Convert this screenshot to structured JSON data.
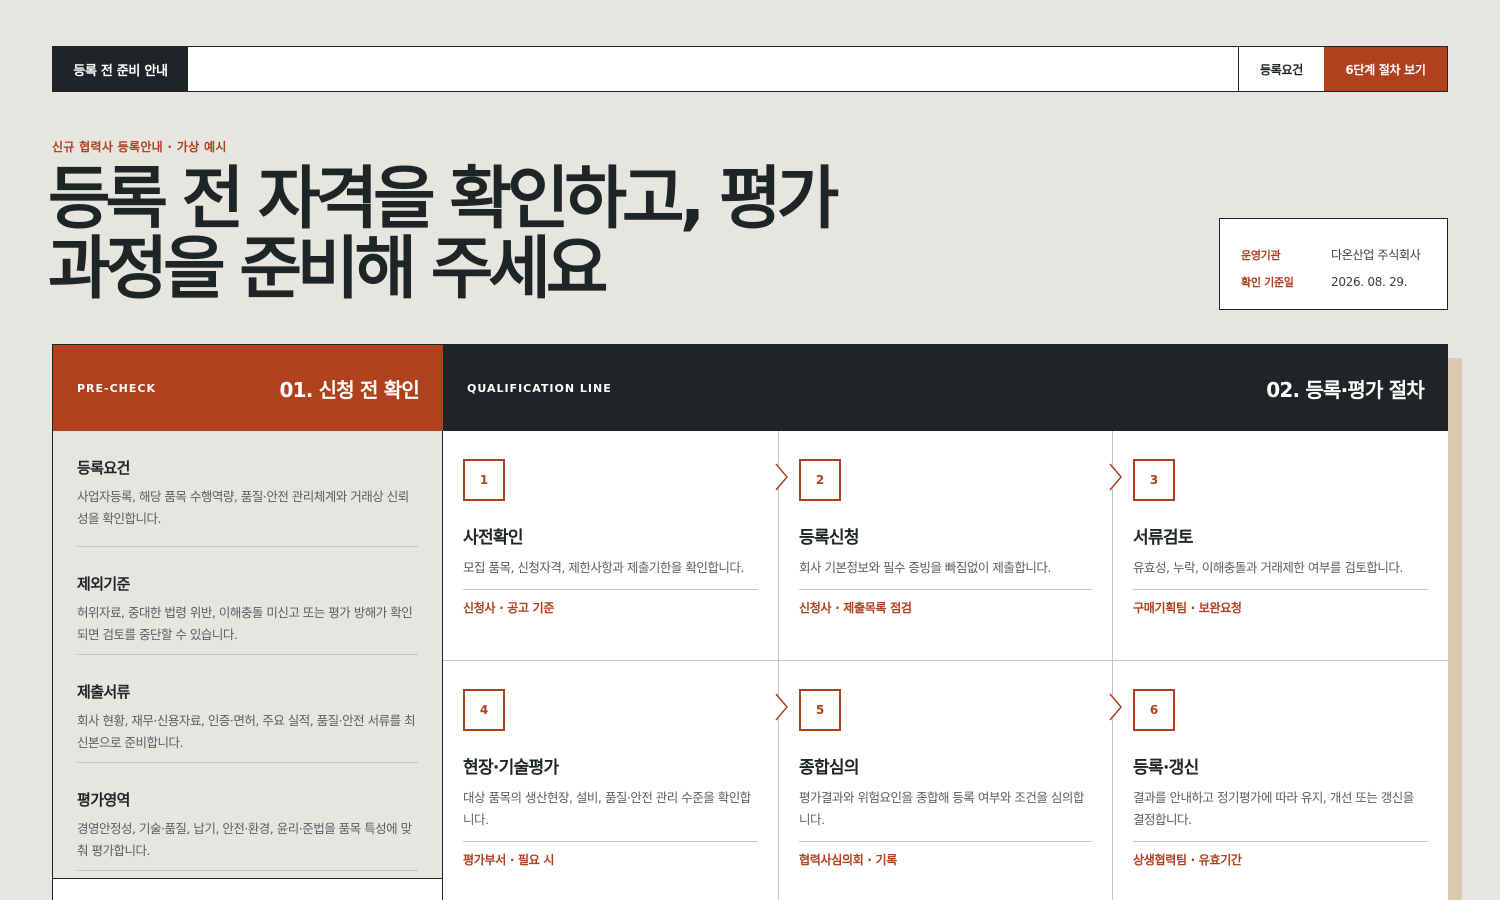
{
  "nav": {
    "brand": "등록 전 준비 안내",
    "requirements_link": "등록요건",
    "cta_button": "6단계 절차 보기"
  },
  "hero": {
    "eyebrow": "신규 협력사 등록안내 · 가상 예시",
    "title_line1": "등록 전 자격을 확인하고, 평가",
    "title_line2": "과정을 준비해 주세요"
  },
  "info": {
    "operator_label": "운영기관",
    "operator_value": "다온산업 주식회사",
    "date_label": "확인 기준일",
    "date_value": "2026. 08. 29."
  },
  "precheck": {
    "tag": "PRE-CHECK",
    "title": "01. 신청 전 확인",
    "items": [
      {
        "title": "등록요건",
        "desc": "사업자등록, 해당 품목 수행역량, 품질·안전 관리체계와 거래상 신뢰성을 확인합니다."
      },
      {
        "title": "제외기준",
        "desc": "허위자료, 중대한 법령 위반, 이해충돌 미신고 또는 평가 방해가 확인되면 검토를 중단할 수 있습니다."
      },
      {
        "title": "제출서류",
        "desc": "회사 현황, 재무·신용자료, 인증·면허, 주요 실적, 품질·안전 서류를 최신본으로 준비합니다."
      },
      {
        "title": "평가영역",
        "desc": "경영안정성, 기술·품질, 납기, 안전·환경, 윤리·준법을 품목 특성에 맞춰 평가합니다."
      }
    ]
  },
  "process": {
    "tag": "QUALIFICATION LINE",
    "title": "02. 등록·평가 절차",
    "steps": [
      {
        "num": "1",
        "title": "사전확인",
        "desc": "모집 품목, 신청자격, 제한사항과 제출기한을 확인합니다.",
        "meta": "신청사 · 공고 기준"
      },
      {
        "num": "2",
        "title": "등록신청",
        "desc": "회사 기본정보와 필수 증빙을 빠짐없이 제출합니다.",
        "meta": "신청사 · 제출목록 점검"
      },
      {
        "num": "3",
        "title": "서류검토",
        "desc": "유효성, 누락, 이해충돌과 거래제한 여부를 검토합니다.",
        "meta": "구매기획팀 · 보완요청"
      },
      {
        "num": "4",
        "title": "현장·기술평가",
        "desc": "대상 품목의 생산현장, 설비, 품질·안전 관리 수준을 확인합니다.",
        "meta": "평가부서 · 필요 시"
      },
      {
        "num": "5",
        "title": "종합심의",
        "desc": "평가결과와 위험요인을 종합해 등록 여부와 조건을 심의합니다.",
        "meta": "협력사심의회 · 기록"
      },
      {
        "num": "6",
        "title": "등록·갱신",
        "desc": "결과를 안내하고 정기평가에 따라 유지, 개선 또는 갱신을 결정합니다.",
        "meta": "상생협력팀 · 유효기간"
      }
    ]
  },
  "colors": {
    "accent": "#b0401e",
    "dark": "#1f2426",
    "background": "#e7e5e0"
  }
}
